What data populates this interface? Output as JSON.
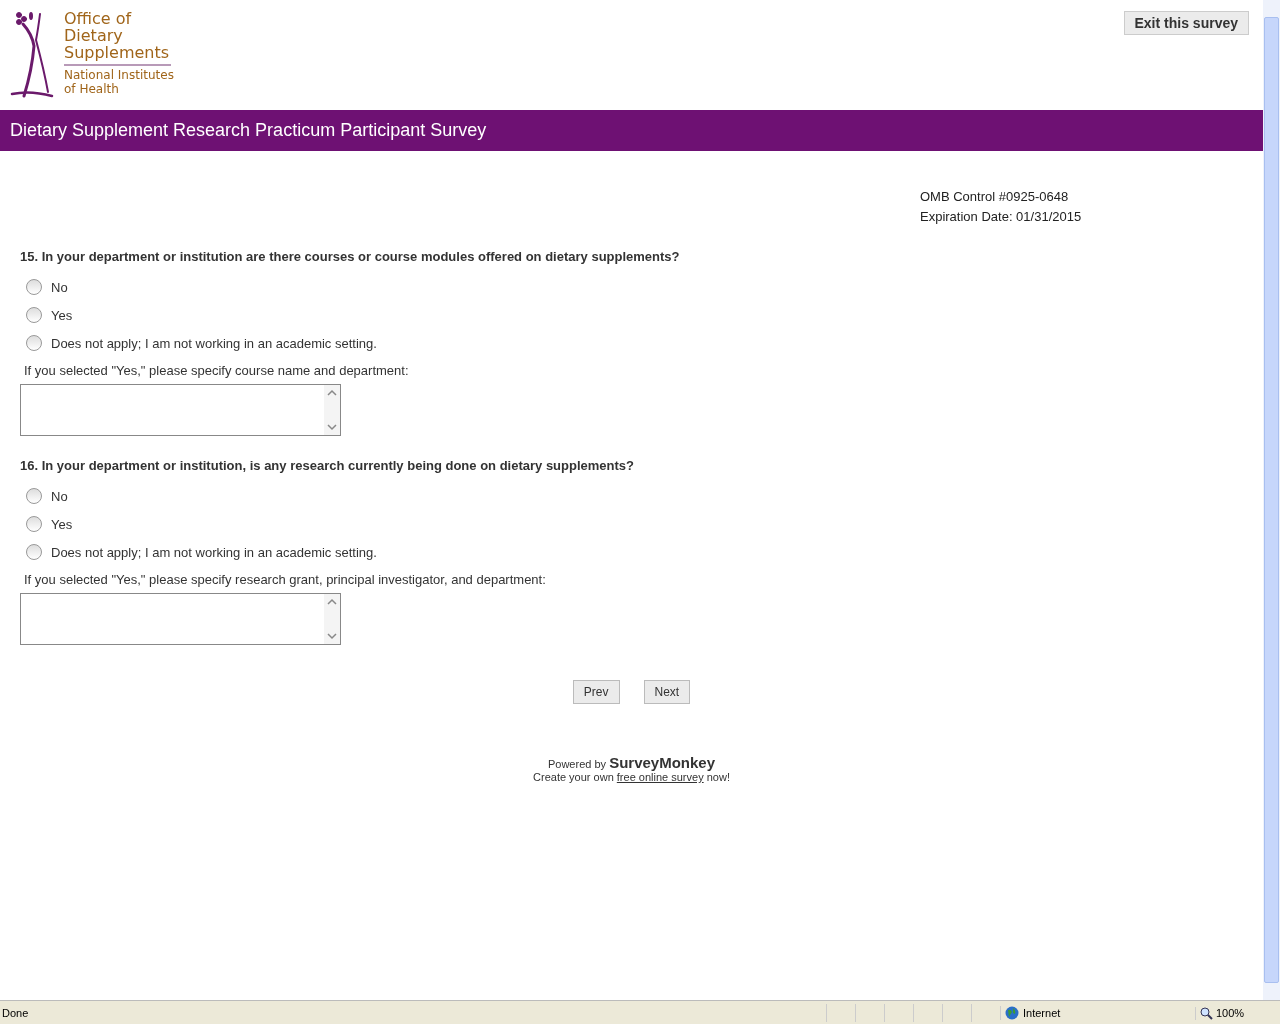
{
  "logo": {
    "lines": [
      "Office of",
      "Dietary",
      "Supplements"
    ],
    "sublines": [
      "National Institutes",
      "of Health"
    ]
  },
  "exit_button": "Exit this survey",
  "header": {
    "title": "Dietary Supplement Research Practicum Participant Survey"
  },
  "omb": [
    "OMB Control #0925-0648",
    "Expiration Date: 01/31/2015"
  ],
  "questions": [
    {
      "title": "15. In your department or institution are there courses or course modules offered on dietary supplements?",
      "options": [
        {
          "label": "No",
          "selected": false
        },
        {
          "label": "Yes",
          "selected": false
        },
        {
          "label": "Does not apply; I am not working in an academic setting.",
          "selected": false
        }
      ],
      "prompt": "If you selected \"Yes,\" please specify course name and department:"
    },
    {
      "title": "16. In your department or institution, is any research currently being done on dietary supplements?",
      "options": [
        {
          "label": "No",
          "selected": false
        },
        {
          "label": "Yes",
          "selected": false
        },
        {
          "label": "Does not apply; I am not working in an academic setting.",
          "selected": false
        }
      ],
      "prompt": "If you selected \"Yes,\" please specify research grant, principal investigator, and department:"
    }
  ],
  "nav_buttons": [
    "Prev",
    "Next"
  ],
  "footer": {
    "powered": "Powered by **SurveyMonkey**",
    "create_before": "Create your own ",
    "create_link": "free online survey",
    "create_after": " now!"
  },
  "status_bar": {
    "status": "Done",
    "zone": "Internet",
    "zoom": "100%"
  }
}
